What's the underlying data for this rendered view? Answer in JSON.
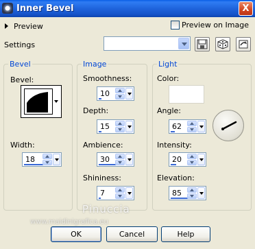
{
  "window": {
    "title": "Inner Bevel",
    "close_glyph": "X"
  },
  "preview": {
    "label": "Preview",
    "preview_on_image_label": "Preview on Image",
    "preview_on_image_checked": false
  },
  "settings": {
    "label": "Settings",
    "value": ""
  },
  "bevel_group": {
    "title": "Bevel",
    "bevel_label": "Bevel:",
    "width_label": "Width:",
    "width_value": "18"
  },
  "image_group": {
    "title": "Image",
    "smoothness_label": "Smoothness:",
    "smoothness_value": "10",
    "depth_label": "Depth:",
    "depth_value": "15",
    "ambience_label": "Ambience:",
    "ambience_value": "30",
    "shininess_label": "Shininess:",
    "shininess_value": "7"
  },
  "light_group": {
    "title": "Light",
    "color_label": "Color:",
    "color_value": "#ffffff",
    "angle_label": "Angle:",
    "angle_value": "62",
    "intensity_label": "Intensity:",
    "intensity_value": "20",
    "elevation_label": "Elevation:",
    "elevation_value": "85"
  },
  "watermark": {
    "line1": "Pinuccia",
    "line2": "www.maidinigrafica.eu"
  },
  "buttons": {
    "ok": "OK",
    "cancel": "Cancel",
    "help": "Help"
  },
  "icons": [
    "app-icon",
    "close-icon",
    "save-icon",
    "randomize-icon",
    "load-icon",
    "dropdown-icon",
    "spin-up-icon",
    "spin-down-icon"
  ],
  "colors": {
    "titlebar": "#1f64dc",
    "group_title": "#0046d5",
    "dialog_bg": "#ece9d8"
  }
}
